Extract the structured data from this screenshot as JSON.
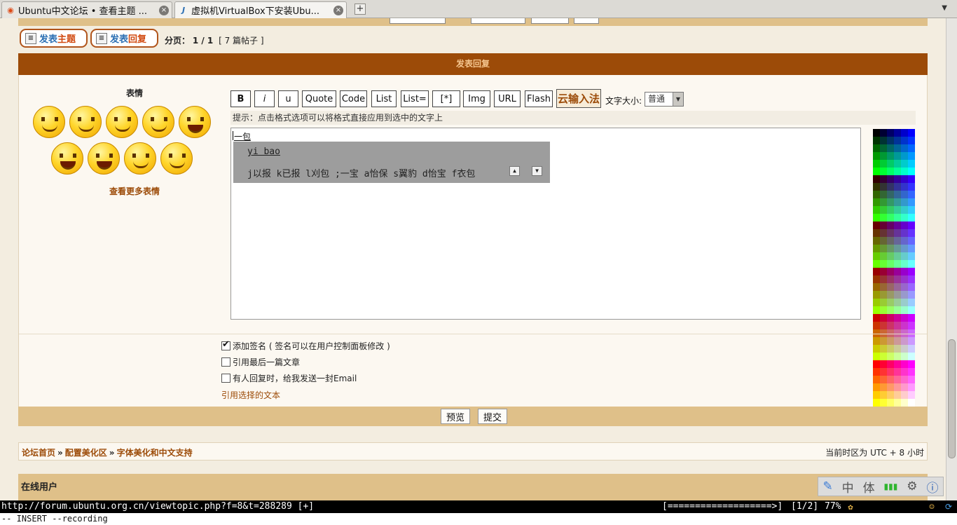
{
  "tabs": [
    {
      "title": "Ubuntu中文论坛 • 查看主题 ...",
      "icon": "ubuntu-icon",
      "active": false
    },
    {
      "title": "虚拟机VirtualBox下安装Ubu...",
      "icon": "javaeye-icon",
      "active": true
    }
  ],
  "new_tab_label": "+",
  "post_buttons": {
    "new_topic": {
      "a": "发表",
      "b": "主题"
    },
    "reply": {
      "a": "发表",
      "b": "回复"
    }
  },
  "pagination": {
    "label": "分页：",
    "value": "1 / 1",
    "count": "[ 7 篇帖子 ]"
  },
  "reply_header": "发表回复",
  "emoticons": {
    "title": "表情",
    "more": "查看更多表情"
  },
  "toolbar": {
    "bold": "B",
    "italic": "i",
    "underline": "u",
    "quote": "Quote",
    "code": "Code",
    "list": "List",
    "list_eq": "List=",
    "star": "[*]",
    "img": "Img",
    "url": "URL",
    "flash": "Flash",
    "ime": "云输入法",
    "fontsize_label": "文字大小:",
    "fontsize_value": "普通"
  },
  "hint": "提示：点击格式选项可以将格式直接应用到选中的文字上",
  "editor": {
    "text": "一包",
    "ime_pinyin": "yi bao",
    "ime_candidates": "j以报 k已报 l刈包 ;一宝 a怡保 s翼豹 d怡宝 f衣包"
  },
  "palette_colors": [
    "#000000",
    "#000033",
    "#000066",
    "#000099",
    "#0000cc",
    "#0000ff",
    "#003300",
    "#003333",
    "#003366",
    "#003399",
    "#0033cc",
    "#0033ff",
    "#006600",
    "#006633",
    "#006666",
    "#006699",
    "#0066cc",
    "#0066ff",
    "#009900",
    "#009933",
    "#009966",
    "#009999",
    "#0099cc",
    "#0099ff",
    "#00cc00",
    "#00cc33",
    "#00cc66",
    "#00cc99",
    "#00cccc",
    "#00ccff",
    "#00ff00",
    "#00ff33",
    "#00ff66",
    "#00ff99",
    "#00ffcc",
    "#00ffff",
    "#330000",
    "#330033",
    "#330066",
    "#330099",
    "#3300cc",
    "#3300ff",
    "#333300",
    "#333333",
    "#333366",
    "#333399",
    "#3333cc",
    "#3333ff",
    "#336600",
    "#336633",
    "#336666",
    "#336699",
    "#3366cc",
    "#3366ff",
    "#339900",
    "#339933",
    "#339966",
    "#339999",
    "#3399cc",
    "#3399ff",
    "#33cc00",
    "#33cc33",
    "#33cc66",
    "#33cc99",
    "#33cccc",
    "#33ccff",
    "#33ff00",
    "#33ff33",
    "#33ff66",
    "#33ff99",
    "#33ffcc",
    "#33ffff",
    "#660000",
    "#660033",
    "#660066",
    "#660099",
    "#6600cc",
    "#6600ff",
    "#663300",
    "#663333",
    "#663366",
    "#663399",
    "#6633cc",
    "#6633ff",
    "#666600",
    "#666633",
    "#666666",
    "#666699",
    "#6666cc",
    "#6666ff",
    "#669900",
    "#669933",
    "#669966",
    "#669999",
    "#6699cc",
    "#6699ff",
    "#66cc00",
    "#66cc33",
    "#66cc66",
    "#66cc99",
    "#66cccc",
    "#66ccff",
    "#66ff00",
    "#66ff33",
    "#66ff66",
    "#66ff99",
    "#66ffcc",
    "#66ffff",
    "#990000",
    "#990033",
    "#990066",
    "#990099",
    "#9900cc",
    "#9900ff",
    "#993300",
    "#993333",
    "#993366",
    "#993399",
    "#9933cc",
    "#9933ff",
    "#996600",
    "#996633",
    "#996666",
    "#996699",
    "#9966cc",
    "#9966ff",
    "#999900",
    "#999933",
    "#999966",
    "#999999",
    "#9999cc",
    "#9999ff",
    "#99cc00",
    "#99cc33",
    "#99cc66",
    "#99cc99",
    "#99cccc",
    "#99ccff",
    "#99ff00",
    "#99ff33",
    "#99ff66",
    "#99ff99",
    "#99ffcc",
    "#99ffff",
    "#cc0000",
    "#cc0033",
    "#cc0066",
    "#cc0099",
    "#cc00cc",
    "#cc00ff",
    "#cc3300",
    "#cc3333",
    "#cc3366",
    "#cc3399",
    "#cc33cc",
    "#cc33ff",
    "#cc6600",
    "#cc6633",
    "#cc6666",
    "#cc6699",
    "#cc66cc",
    "#cc66ff",
    "#cc9900",
    "#cc9933",
    "#cc9966",
    "#cc9999",
    "#cc99cc",
    "#cc99ff",
    "#cccc00",
    "#cccc33",
    "#cccc66",
    "#cccc99",
    "#cccccc",
    "#ccccff",
    "#ccff00",
    "#ccff33",
    "#ccff66",
    "#ccff99",
    "#ccffcc",
    "#ccffff",
    "#ff0000",
    "#ff0033",
    "#ff0066",
    "#ff0099",
    "#ff00cc",
    "#ff00ff",
    "#ff3300",
    "#ff3333",
    "#ff3366",
    "#ff3399",
    "#ff33cc",
    "#ff33ff",
    "#ff6600",
    "#ff6633",
    "#ff6666",
    "#ff6699",
    "#ff66cc",
    "#ff66ff",
    "#ff9900",
    "#ff9933",
    "#ff9966",
    "#ff9999",
    "#ff99cc",
    "#ff99ff",
    "#ffcc00",
    "#ffcc33",
    "#ffcc66",
    "#ffcc99",
    "#ffcccc",
    "#ffccff",
    "#ffff00",
    "#ffff33",
    "#ffff66",
    "#ffff99",
    "#ffffcc",
    "#ffffff"
  ],
  "options": {
    "signature": "添加签名 ( 签名可以在用户控制面板修改 )",
    "quote_last": "引用最后一篇文章",
    "notify": "有人回复时，给我发送一封Email",
    "quote_selected": "引用选择的文本"
  },
  "actions": {
    "preview": "预览",
    "submit": "提交"
  },
  "breadcrumb": {
    "home": "论坛首页",
    "sep": "»",
    "section": "配置美化区",
    "subsection": "字体美化和中文支持"
  },
  "timezone": "当前时区为 UTC + 8 小时",
  "online_users": "在线用户",
  "ime_toolbar": {
    "zh": "中",
    "ti": "体"
  },
  "statusbar": {
    "url": "http://forum.ubuntu.org.cn/viewtopic.php?f=8&t=288289 [+]",
    "progress": "[===================>]",
    "position": "[1/2]",
    "zoom": "77%"
  },
  "cmdline": "-- INSERT --recording",
  "colors": {
    "header_brown": "#9c4b08",
    "bar_tan": "#dfc089",
    "link_brown": "#9c4b08",
    "panel": "#fcf8f1"
  }
}
